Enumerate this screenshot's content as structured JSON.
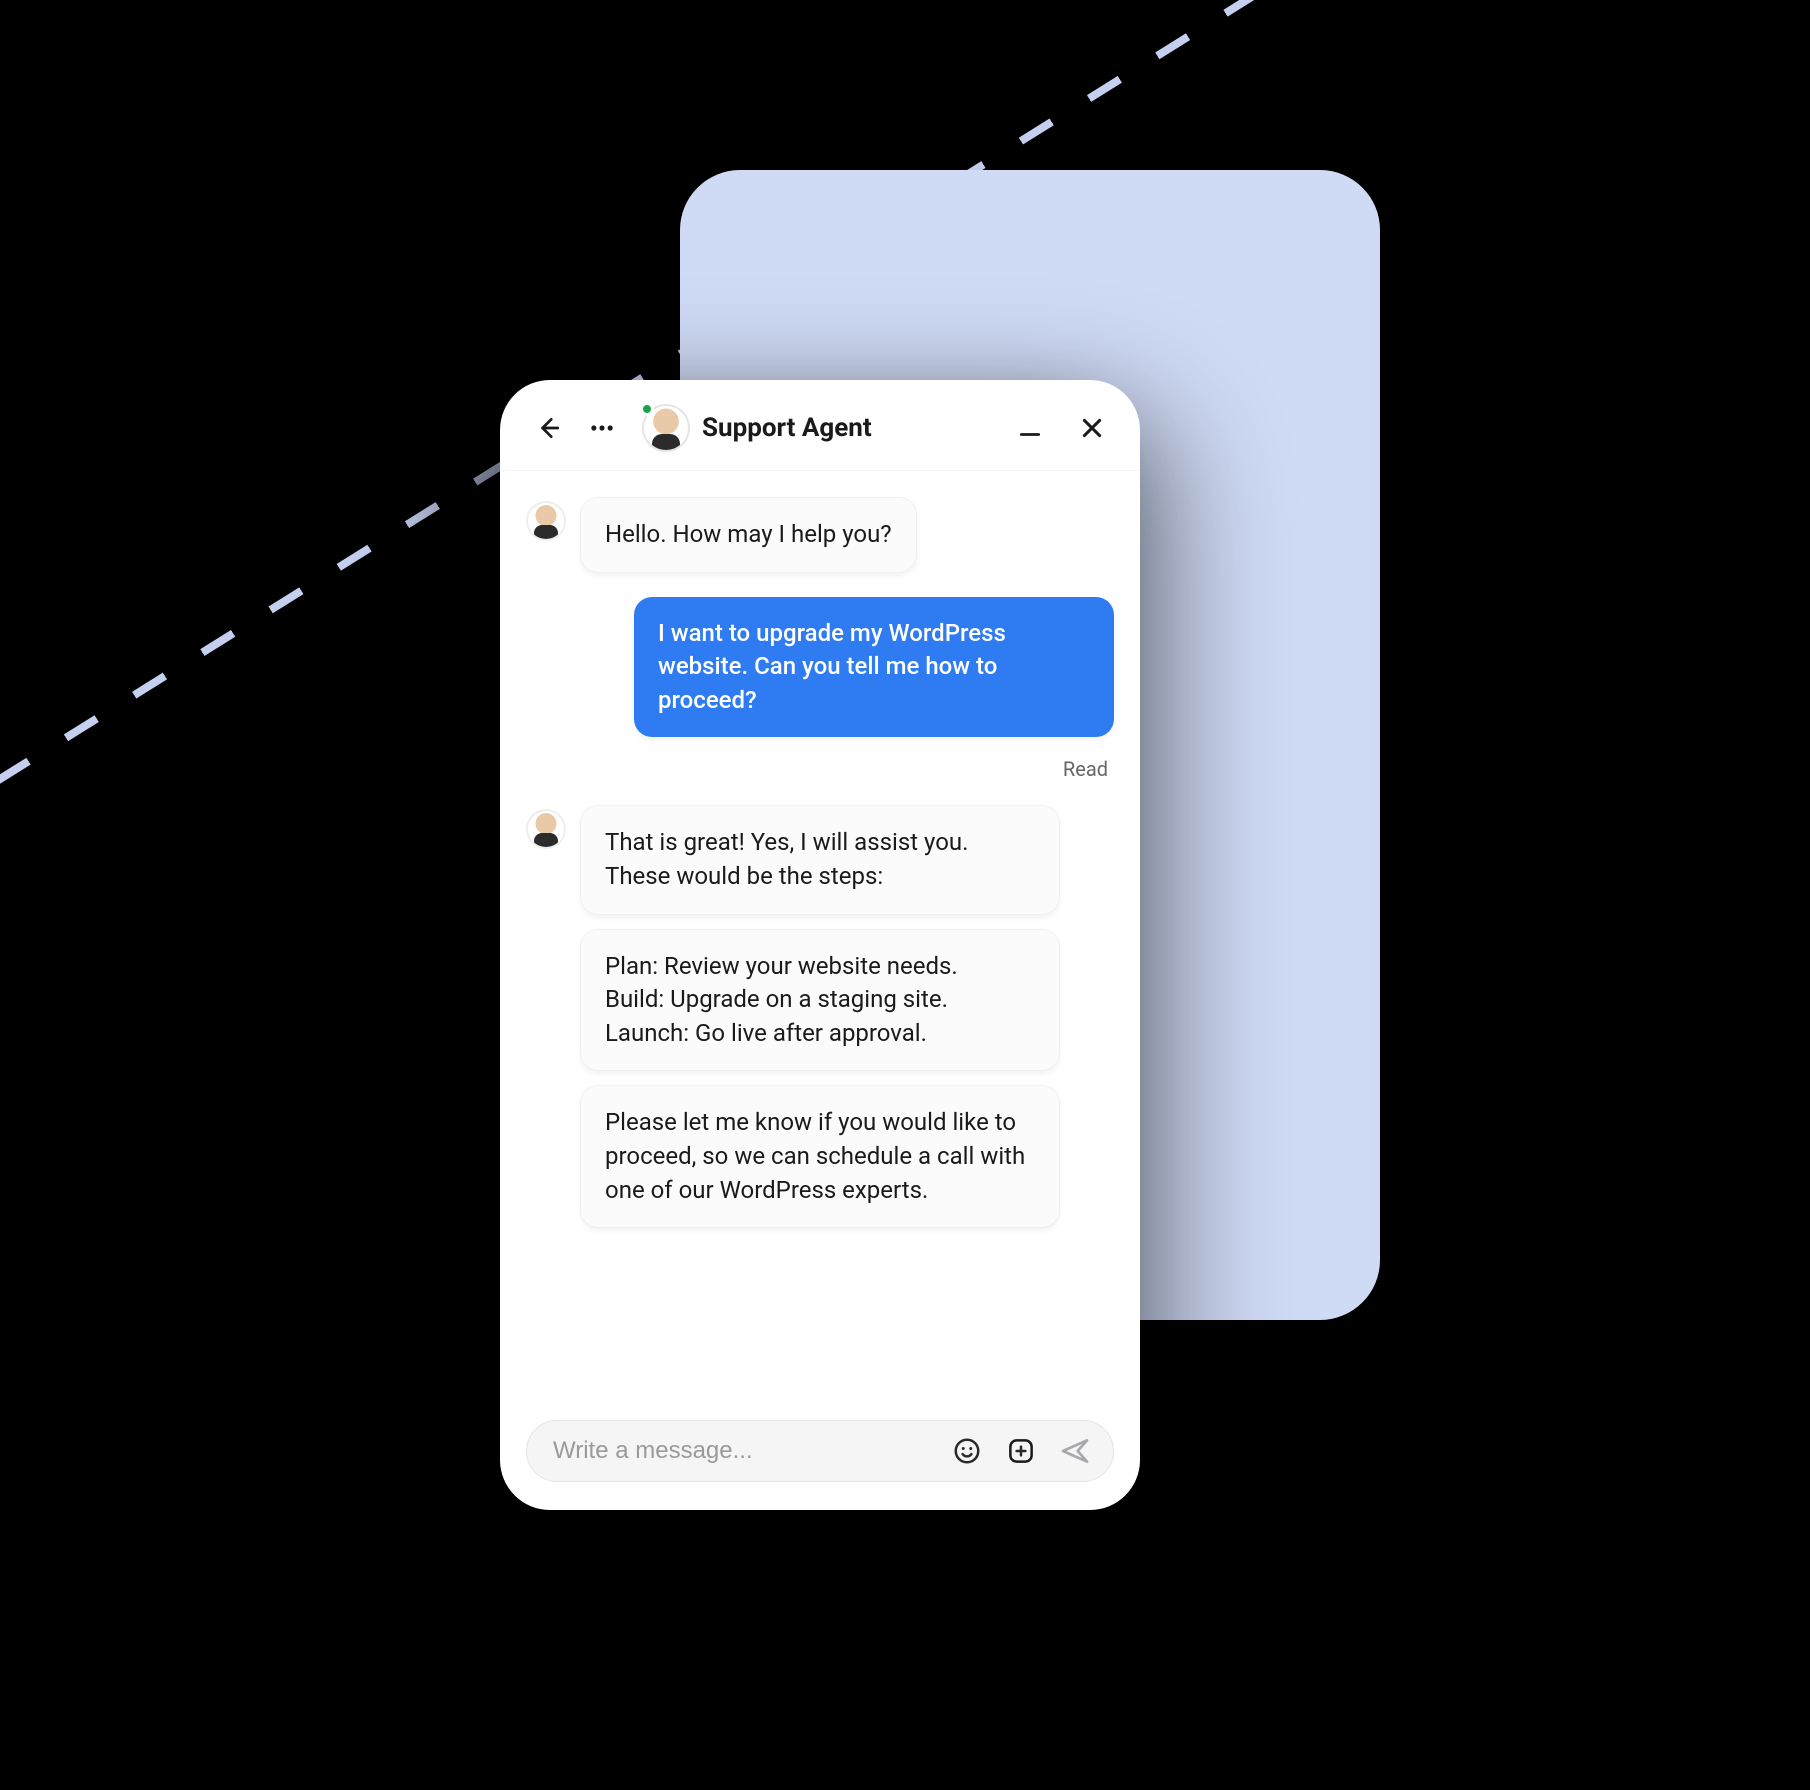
{
  "header": {
    "title": "Support Agent",
    "icons": {
      "back": "back-arrow-icon",
      "more": "more-options-icon",
      "minimize": "minimize-icon",
      "close": "close-icon"
    }
  },
  "messages": [
    {
      "sender": "agent",
      "text": "Hello. How may I help you?"
    },
    {
      "sender": "user",
      "text": "I want to upgrade my WordPress website. Can you tell me how to proceed?",
      "status": "Read"
    },
    {
      "sender": "agent",
      "text": "That is great! Yes, I will assist you. These would be the steps:"
    },
    {
      "sender": "agent",
      "text": "Plan: Review your website needs.\nBuild: Upgrade on a staging site.\nLaunch: Go live after approval."
    },
    {
      "sender": "agent",
      "text": "Please let me know if you would like to proceed, so we can schedule a call with one of our WordPress experts."
    }
  ],
  "input": {
    "placeholder": "Write a message...",
    "icons": {
      "emoji": "emoji-icon",
      "add": "plus-box-icon",
      "send": "send-icon"
    }
  }
}
